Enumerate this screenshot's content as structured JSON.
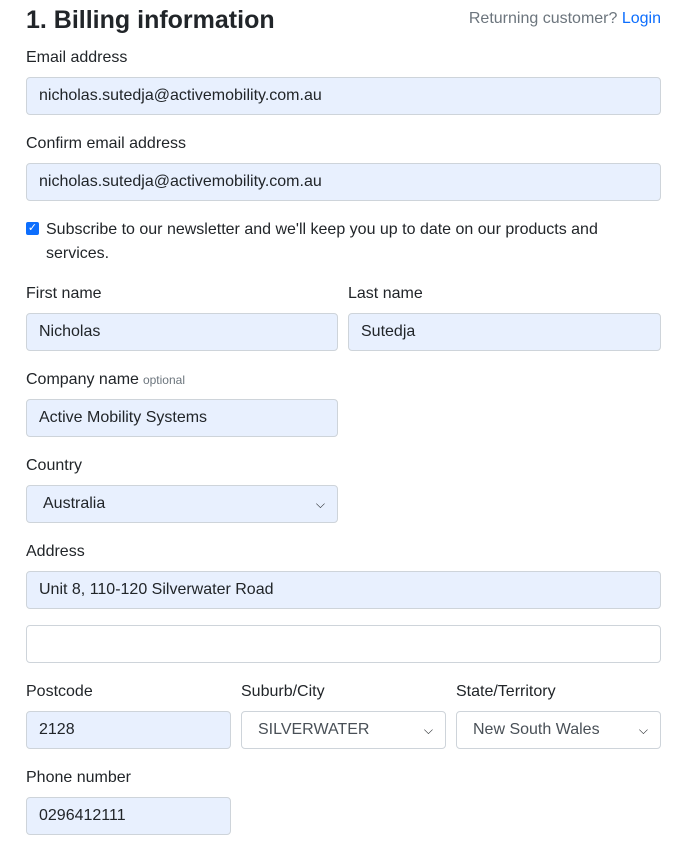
{
  "header": {
    "title": "1. Billing information",
    "returning_text": "Returning customer?",
    "login_link": "Login"
  },
  "form": {
    "email_label": "Email address",
    "email_value": "nicholas.sutedja@activemobility.com.au",
    "confirm_email_label": "Confirm email address",
    "confirm_email_value": "nicholas.sutedja@activemobility.com.au",
    "newsletter_checked": true,
    "newsletter_label": "Subscribe to our newsletter and we'll keep you up to date on our products and services.",
    "first_name_label": "First name",
    "first_name_value": "Nicholas",
    "last_name_label": "Last name",
    "last_name_value": "Sutedja",
    "company_label": "Company name",
    "company_optional": "optional",
    "company_value": "Active Mobility Systems",
    "country_label": "Country",
    "country_value": "Australia",
    "address_label": "Address",
    "address_line1_value": "Unit 8, 110-120 Silverwater Road",
    "address_line2_value": "",
    "postcode_label": "Postcode",
    "postcode_value": "2128",
    "suburb_label": "Suburb/City",
    "suburb_value": "SILVERWATER",
    "state_label": "State/Territory",
    "state_value": "New South Wales",
    "phone_label": "Phone number",
    "phone_value": "0296412111"
  },
  "colors": {
    "autofill_bg": "#e8f0fe",
    "link": "#0d6efd",
    "muted": "#6c757d"
  }
}
